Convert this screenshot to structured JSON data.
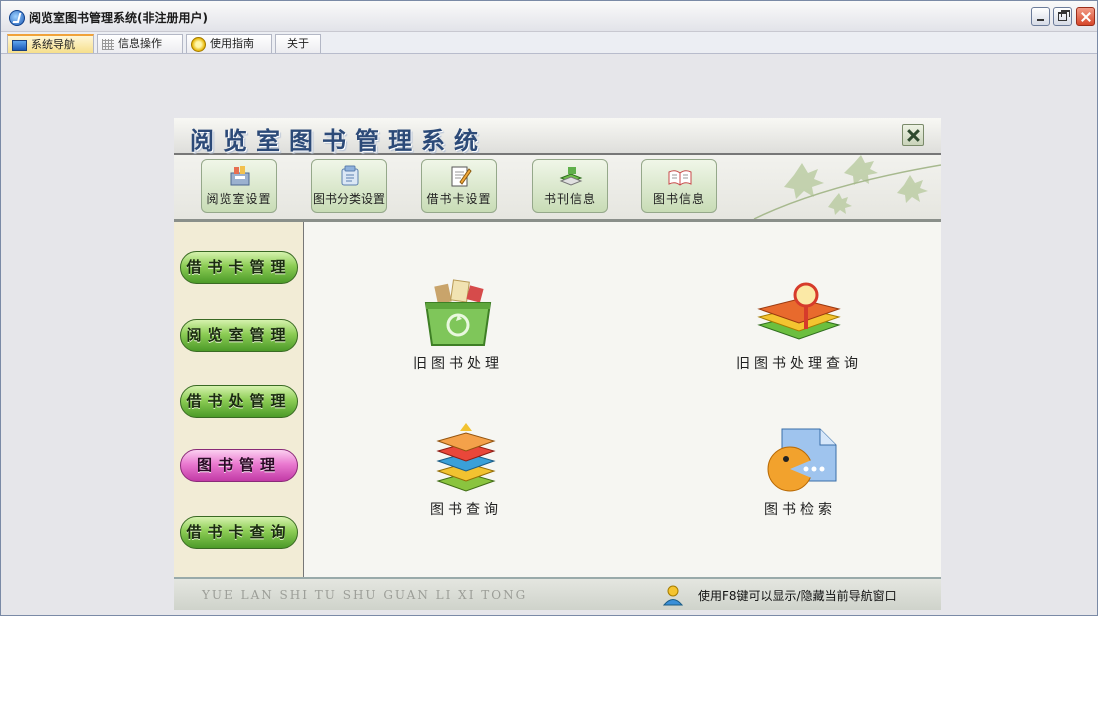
{
  "window": {
    "title": "阅览室图书管理系统(非注册用户)",
    "controls": {
      "minimize": "minimize-icon",
      "restore": "restore-icon",
      "close": "close-icon"
    }
  },
  "tabs": [
    {
      "label": "系统导航",
      "icon": "monitor-icon",
      "active": true
    },
    {
      "label": "信息操作",
      "icon": "grid-icon",
      "active": false
    },
    {
      "label": "使用指南",
      "icon": "help-icon",
      "active": false
    },
    {
      "label": "关于",
      "icon": "",
      "active": false
    }
  ],
  "panel": {
    "title": "阅览室图书管理系统",
    "toolbar": [
      {
        "label": "阅览室设置",
        "icon": "reading-room-settings-icon"
      },
      {
        "label": "图书分类设置",
        "icon": "book-category-settings-icon"
      },
      {
        "label": "借书卡设置",
        "icon": "library-card-settings-icon"
      },
      {
        "label": "书刊信息",
        "icon": "periodical-info-icon"
      },
      {
        "label": "图书信息",
        "icon": "book-info-icon"
      }
    ],
    "sidebar": [
      {
        "label": "借书卡管理",
        "selected": false
      },
      {
        "label": "阅览室管理",
        "selected": false
      },
      {
        "label": "借书处管理",
        "selected": false
      },
      {
        "label": "图书管理",
        "selected": true
      },
      {
        "label": "借书卡查询",
        "selected": false
      }
    ],
    "features": [
      {
        "label": "旧图书处理",
        "icon": "recycle-bin-icon"
      },
      {
        "label": "旧图书处理查询",
        "icon": "book-magnifier-icon"
      },
      {
        "label": "图书查询",
        "icon": "book-stack-icon"
      },
      {
        "label": "图书检索",
        "icon": "search-folder-icon"
      }
    ],
    "footer": {
      "left": "YUE LAN SHI TU SHU GUAN LI XI TONG",
      "hint": "使用F8键可以显示/隐藏当前导航窗口"
    }
  },
  "colors": {
    "accent": "#f0a23a",
    "side_button_green": "#8dcd55",
    "side_button_selected": "#ea7ad0",
    "title_blue": "#2c4a78"
  }
}
